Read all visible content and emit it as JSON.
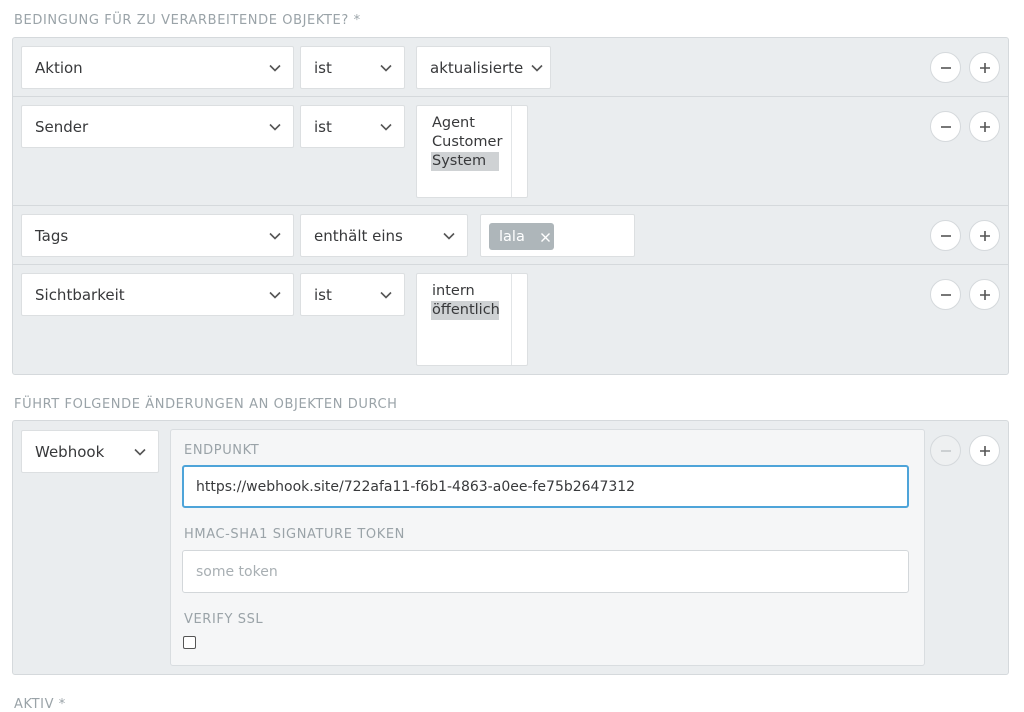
{
  "conditions": {
    "heading": "Bedingung für zu verarbeitende Objekte? *",
    "rows": [
      {
        "attribute": "Aktion",
        "operator": "ist",
        "value_select": "aktualisierte"
      },
      {
        "attribute": "Sender",
        "operator": "ist",
        "options": [
          "Agent",
          "Customer",
          "System"
        ],
        "selected_option": "System"
      },
      {
        "attribute": "Tags",
        "operator": "enthält eins",
        "tags": [
          {
            "label": "lala",
            "remove_glyph": "×"
          }
        ]
      },
      {
        "attribute": "Sichtbarkeit",
        "operator": "ist",
        "options": [
          "intern",
          "öffentlich"
        ],
        "selected_option": "öffentlich"
      }
    ],
    "row_buttons": {
      "remove_icon": "minus-icon",
      "add_icon": "plus-icon"
    }
  },
  "actions": {
    "heading": "Führt folgende Änderungen an Objekten durch",
    "type_select": "Webhook",
    "endpoint": {
      "label": "Endpunkt",
      "value": "https://webhook.site/722afa11-f6b1-4863-a0ee-fe75b2647312"
    },
    "hmac": {
      "label": "HMAC-SHA1 Signature Token",
      "placeholder": "some token",
      "value": ""
    },
    "verify_ssl": {
      "label": "Verify SSL",
      "checked": false
    },
    "remove_disabled": true
  },
  "next_section": {
    "heading": "Aktiv *"
  },
  "colors": {
    "panel_bg": "#eaedef",
    "label": "#9aa3a8",
    "focus_border": "#4ea4d9",
    "tag_bg": "#aeb6ba",
    "selected_option_bg": "#cfd2d4"
  }
}
